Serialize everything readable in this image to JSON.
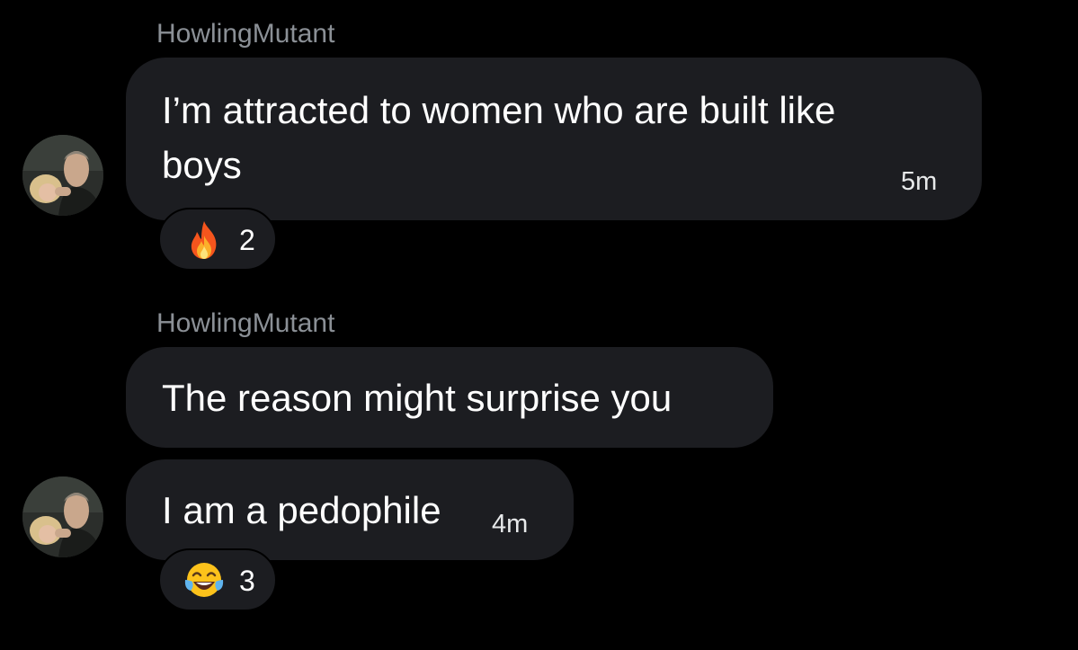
{
  "messages": [
    {
      "sender": "HowlingMutant",
      "text_line1": "I’m attracted to women who are built like",
      "text_line2": "boys",
      "time": "5m",
      "reaction": {
        "emoji": "fire-icon",
        "count": "2"
      }
    },
    {
      "sender": "HowlingMutant",
      "text": "The reason might surprise you"
    },
    {
      "text": "I am a pedophile",
      "time": "4m",
      "reaction": {
        "emoji": "tears-of-joy-icon",
        "count": "3"
      }
    }
  ],
  "colors": {
    "background": "#000000",
    "bubble": "#1c1d21",
    "sender": "#8b9096",
    "text": "#ffffff"
  }
}
